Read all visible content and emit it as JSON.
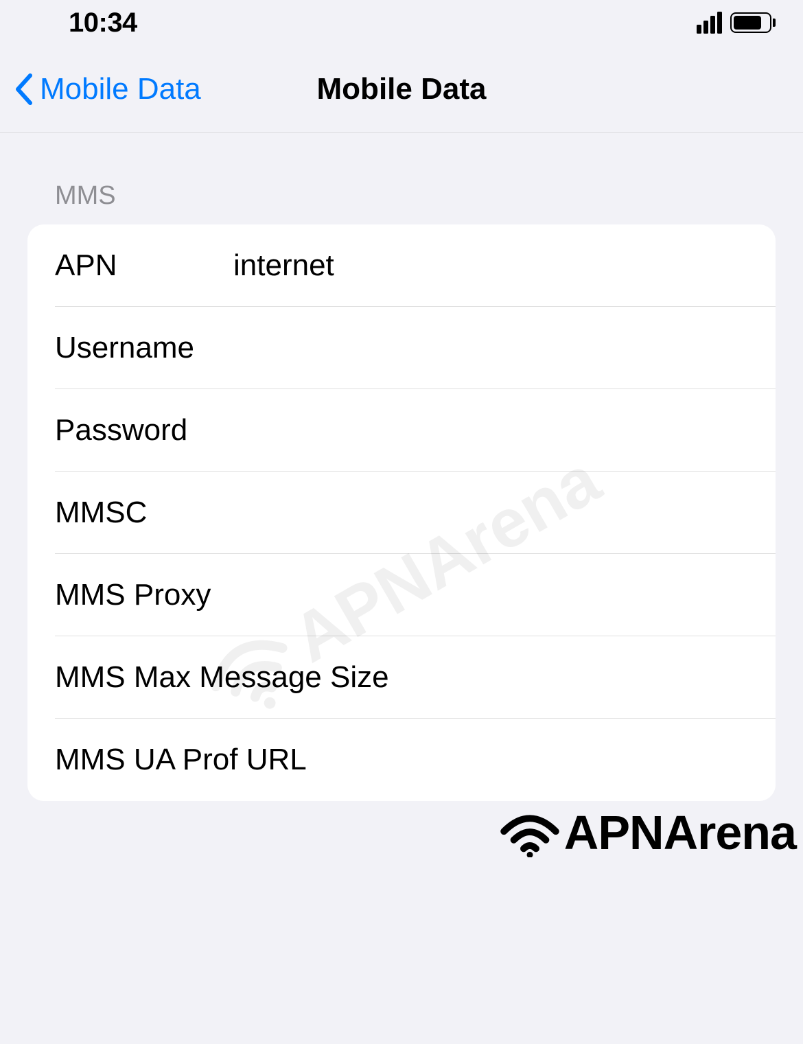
{
  "status": {
    "time": "10:34"
  },
  "nav": {
    "back_label": "Mobile Data",
    "title": "Mobile Data"
  },
  "section": {
    "header": "MMS",
    "rows": [
      {
        "label": "APN",
        "value": "internet",
        "wide": false
      },
      {
        "label": "Username",
        "value": "",
        "wide": false
      },
      {
        "label": "Password",
        "value": "",
        "wide": false
      },
      {
        "label": "MMSC",
        "value": "",
        "wide": false
      },
      {
        "label": "MMS Proxy",
        "value": "",
        "wide": false
      },
      {
        "label": "MMS Max Message Size",
        "value": "",
        "wide": true
      },
      {
        "label": "MMS UA Prof URL",
        "value": "",
        "wide": true
      }
    ]
  },
  "watermark": "APNArena",
  "footer_logo": "APNArena"
}
